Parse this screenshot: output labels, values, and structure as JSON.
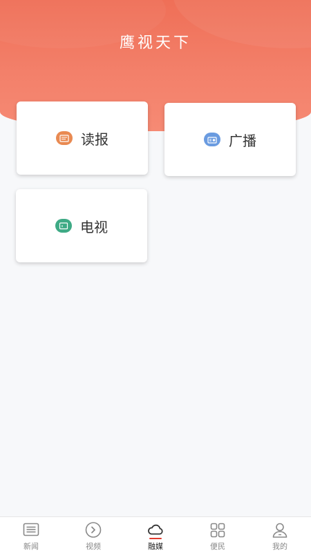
{
  "header": {
    "title": "鹰视天下"
  },
  "cards": [
    {
      "label": "读报",
      "icon": "newspaper-icon",
      "color": "#e98a52"
    },
    {
      "label": "广播",
      "icon": "radio-icon",
      "color": "#6a9be0"
    },
    {
      "label": "电视",
      "icon": "tv-icon",
      "color": "#3eaa85"
    }
  ],
  "tabbar": {
    "items": [
      {
        "label": "新闻",
        "icon": "news-icon"
      },
      {
        "label": "视频",
        "icon": "play-circle-icon"
      },
      {
        "label": "融媒",
        "icon": "cloud-icon",
        "active": true
      },
      {
        "label": "便民",
        "icon": "grid-icon"
      },
      {
        "label": "我的",
        "icon": "user-icon"
      }
    ],
    "active_color": "#e23b2e"
  }
}
